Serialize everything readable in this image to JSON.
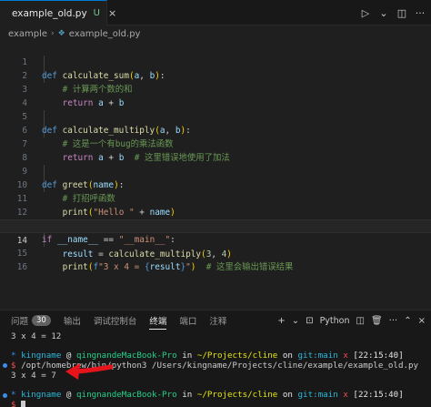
{
  "tab": {
    "filename": "example_old.py",
    "badge": "U",
    "close": "×"
  },
  "tab_actions": {
    "run": "▷",
    "run_menu": "⌄",
    "split": "◫",
    "more": "···"
  },
  "breadcrumb": {
    "folder": "example",
    "sep": "›",
    "file": "example_old.py"
  },
  "editor": {
    "line_numbers": [
      "1",
      "2",
      "3",
      "4",
      "5",
      "6",
      "7",
      "8",
      "9",
      "10",
      "11",
      "12",
      "13",
      "14",
      "15",
      "16"
    ],
    "active_line": "14"
  },
  "panel": {
    "tabs": [
      {
        "label": "问题",
        "badge": "30"
      },
      {
        "label": "输出"
      },
      {
        "label": "调试控制台"
      },
      {
        "label": "终端",
        "active": true
      },
      {
        "label": "端口"
      },
      {
        "label": "注释"
      }
    ],
    "actions": {
      "add": "+",
      "add_menu": "⌄",
      "terminal_icon": "⊡",
      "terminal_label": "Python",
      "split": "◫",
      "trash": "🗑",
      "more": "···",
      "maximize": "⌃",
      "close": "×"
    }
  },
  "terminal": {
    "prev_output": "3 x 4 = 12",
    "prompt1": {
      "star": "*",
      "user": "kingname",
      "at": "@",
      "host": "qingnandeMacBook-Pro",
      "in": "in",
      "path": "~/Projects/cline",
      "on": "on",
      "git": "git:main",
      "x": "x",
      "time": "[22:15:40]"
    },
    "cmd_prompt": "$",
    "command": "/opt/homebrew/bin/python3 /Users/kingname/Projects/cline/example/example_old.py",
    "output": "3 x 4 = 7",
    "prompt2": {
      "star": "*",
      "user": "kingname",
      "at": "@",
      "host": "qingnandeMacBook-Pro",
      "in": "in",
      "path": "~/Projects/cline",
      "on": "on",
      "git": "git:main",
      "x": "x",
      "time": "[22:15:40]"
    },
    "final_prompt": "$"
  },
  "colors": {
    "accent": "#0078d4",
    "arrow": "#e8141b",
    "untracked": "#73c991"
  },
  "code": {
    "l1": {
      "kw": "def",
      "fn": "calculate_sum",
      "p1": "a",
      "p2": "b"
    },
    "l2": {
      "comment": "# 计算两个数的和"
    },
    "l3": {
      "kw": "return",
      "a": "a",
      "op": "+",
      "b": "b"
    },
    "l5": {
      "kw": "def",
      "fn": "calculate_multiply",
      "p1": "a",
      "p2": "b"
    },
    "l6": {
      "comment": "# 这是一个有bug的乘法函数"
    },
    "l7": {
      "kw": "return",
      "a": "a",
      "op": "+",
      "b": "b",
      "comment": "# 这里错误地使用了加法"
    },
    "l9": {
      "kw": "def",
      "fn": "greet",
      "p1": "name"
    },
    "l10": {
      "comment": "# 打招呼函数"
    },
    "l11": {
      "fn": "print",
      "s": "\"Hello \"",
      "op": "+",
      "v": "name"
    },
    "l13": {
      "kw": "if",
      "v": "__name__",
      "op": "==",
      "s": "\"__main__\""
    },
    "l14": {
      "v": "result",
      "op": "=",
      "fn": "calculate_multiply",
      "n1": "3",
      "n2": "4"
    },
    "l15": {
      "fn": "print",
      "f": "f",
      "s1": "\"3 x 4 = ",
      "lb": "{",
      "v": "result",
      "rb": "}",
      "s2": "\"",
      "comment": "# 这里会输出错误结果"
    }
  }
}
